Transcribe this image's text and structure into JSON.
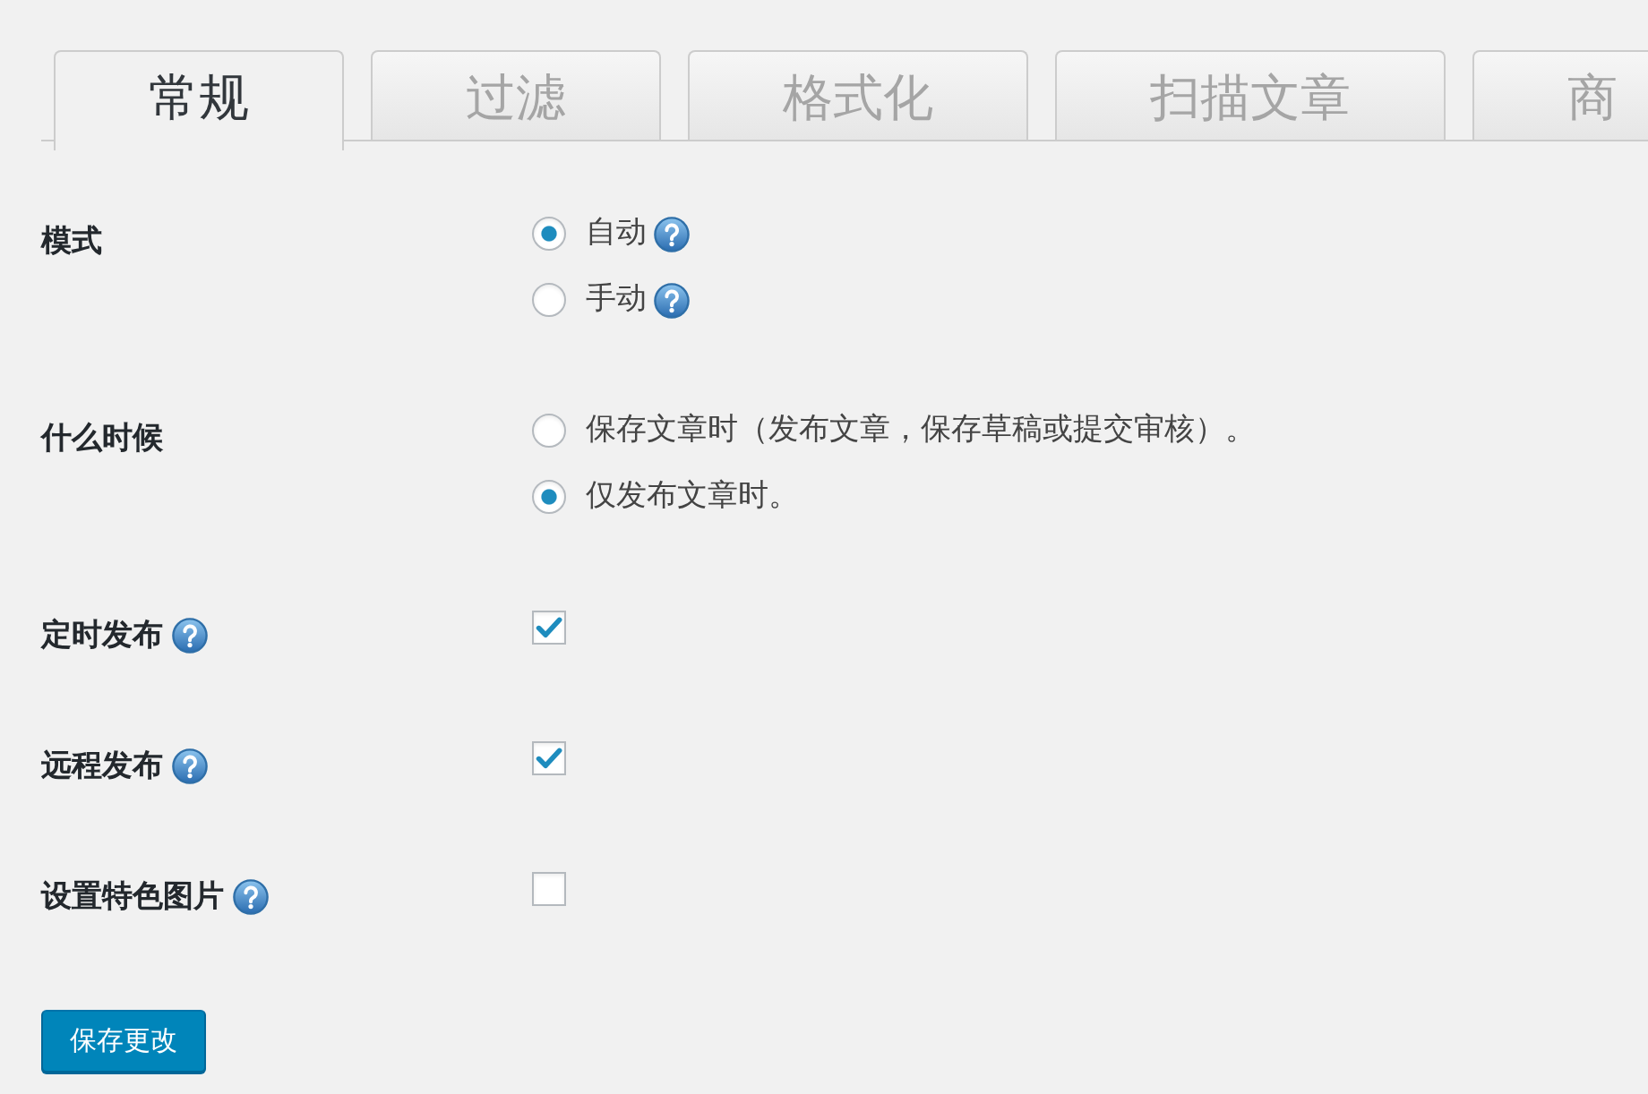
{
  "tabs": [
    {
      "label": "常规",
      "selected": true
    },
    {
      "label": "过滤",
      "selected": false
    },
    {
      "label": "格式化",
      "selected": false
    },
    {
      "label": "扫描文章",
      "selected": false
    },
    {
      "label": "商",
      "selected": false
    }
  ],
  "settings": [
    {
      "kind": "radio",
      "label": "模式",
      "help": false,
      "options": [
        {
          "label": "自动",
          "selected": true,
          "help": true
        },
        {
          "label": "手动",
          "selected": false,
          "help": true
        }
      ]
    },
    {
      "kind": "radio",
      "label": "什么时候",
      "help": false,
      "options": [
        {
          "label": "保存文章时（发布文章，保存草稿或提交审核）。",
          "selected": false,
          "help": false
        },
        {
          "label": "仅发布文章时。",
          "selected": true,
          "help": false
        }
      ]
    },
    {
      "kind": "checkbox",
      "label": "定时发布",
      "help": true,
      "checked": true
    },
    {
      "kind": "checkbox",
      "label": "远程发布",
      "help": true,
      "checked": true
    },
    {
      "kind": "checkbox",
      "label": "设置特色图片",
      "help": true,
      "checked": false
    }
  ],
  "save_button": "保存更改"
}
